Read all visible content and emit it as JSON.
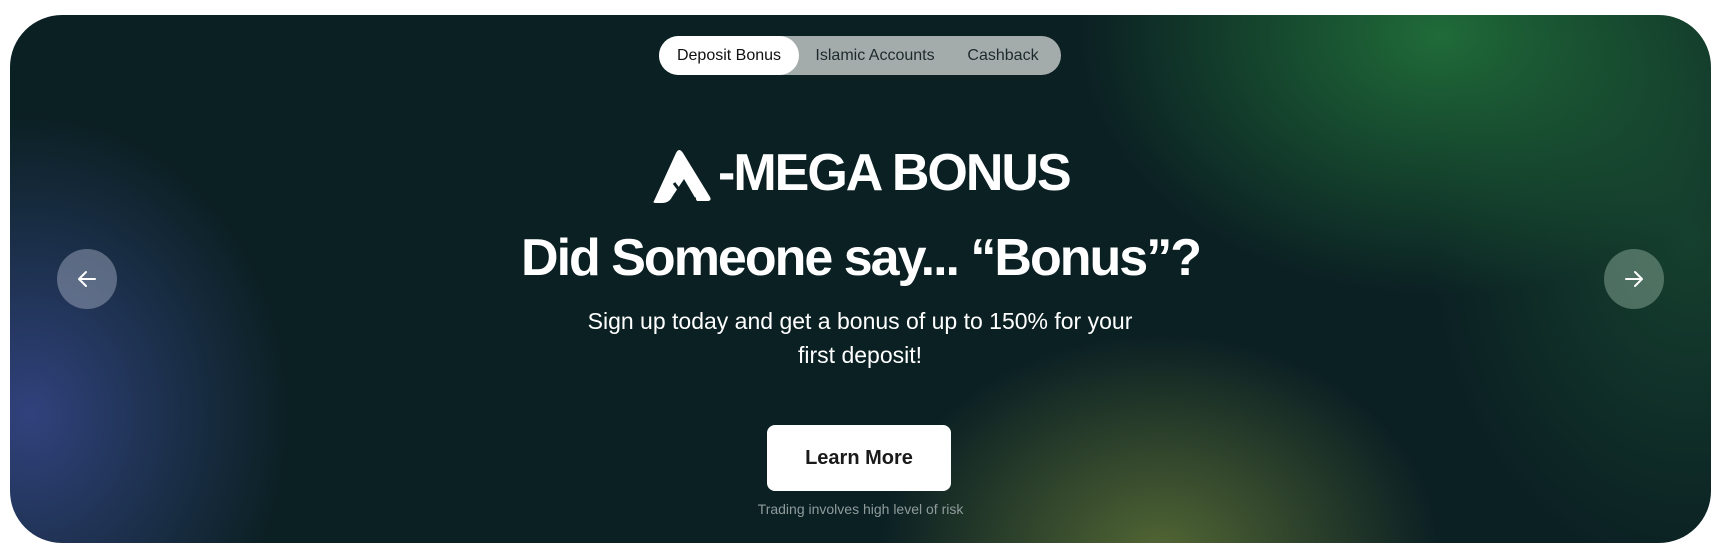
{
  "tabs": [
    {
      "label": "Deposit Bonus",
      "active": true
    },
    {
      "label": "Islamic Accounts",
      "active": false
    },
    {
      "label": "Cashback",
      "active": false
    }
  ],
  "hero": {
    "logo_text": "-MEGA BONUS",
    "logo_icon": "a-logo-icon",
    "headline": "Did Someone say... “Bonus”?",
    "subtitle": "Sign up today and get a bonus of up to 150% for your first deposit!",
    "cta_label": "Learn More",
    "disclaimer": "Trading involves high level of risk"
  },
  "nav": {
    "prev_icon": "arrow-left-icon",
    "next_icon": "arrow-right-icon"
  },
  "colors": {
    "background": "#0b2023",
    "accent_green": "#23783c",
    "accent_blue": "#37488c"
  }
}
